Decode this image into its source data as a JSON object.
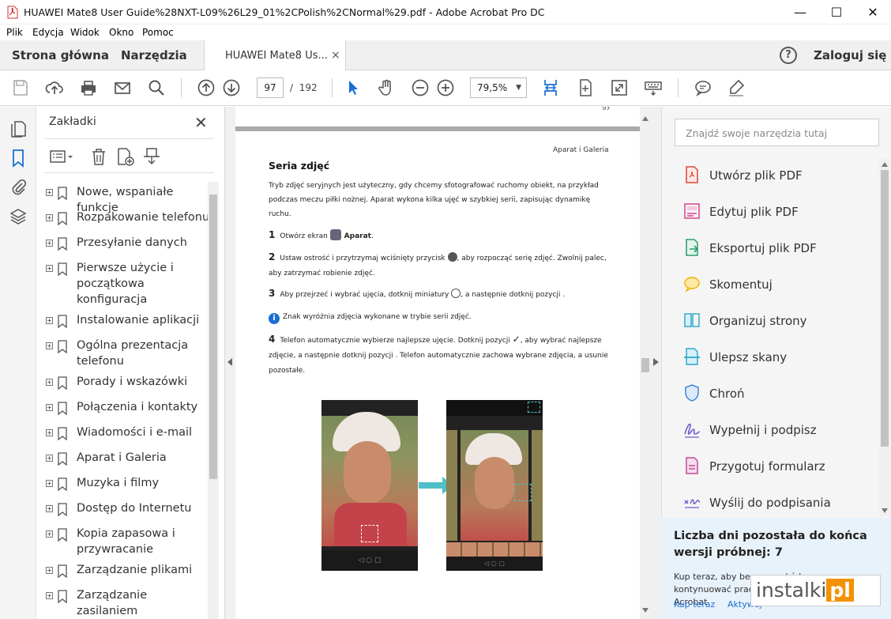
{
  "window": {
    "title": "HUAWEI Mate8 User Guide%28NXT-L09%26L29_01%2CPolish%2CNormal%29.pdf - Adobe Acrobat Pro DC",
    "minimize": "—",
    "maximize": "☐",
    "close": "✕"
  },
  "menu": [
    "Plik",
    "Edycja",
    "Widok",
    "Okno",
    "Pomoc"
  ],
  "tabs": {
    "home": "Strona główna",
    "tools": "Narzędzia",
    "document": "HUAWEI Mate8 Us...",
    "close": "×",
    "help": "?",
    "login": "Zaloguj się"
  },
  "toolbar": {
    "icons": [
      "save-icon",
      "upload-icon",
      "print-icon",
      "email-icon",
      "search-icon",
      "page-up-icon",
      "page-down-icon",
      "select-cursor-icon",
      "hand-icon",
      "zoom-out-icon",
      "zoom-in-icon",
      "fit-width-icon",
      "rotate-icon",
      "fullscreen-icon",
      "keyboard-icon",
      "comment-icon",
      "highlight-icon"
    ],
    "page_current": "97",
    "page_sep": "/",
    "page_total": "192",
    "zoom": "79,5%",
    "zoom_arrow": "▼"
  },
  "bookmarks": {
    "header": "Zakładki",
    "close": "✕",
    "expand_symbol": "+",
    "items": [
      "Nowe, wspaniałe funkcje",
      "Rozpakowanie telefonu",
      "Przesyłanie danych",
      "Pierwsze użycie i początkowa konfiguracja",
      "Instalowanie aplikacji",
      "Ogólna prezentacja telefonu",
      "Porady i wskazówki",
      "Połączenia i kontakty",
      "Wiadomości i e-mail",
      "Aparat i Galeria",
      "Muzyka i filmy",
      "Dostęp do Internetu",
      "Kopia zapasowa i przywracanie",
      "Zarządzanie plikami",
      "Zarządzanie zasilaniem"
    ]
  },
  "document": {
    "running_header": "Aparat i Galeria",
    "heading": "Seria  zdjęć",
    "intro": "Tryb zdjęć seryjnych jest użyteczny, gdy chcemy sfotografować ruchomy obiekt, na przykład podczas meczu piłki nożnej. Aparat wykona kilka ujęć w szybkiej serii, zapisując dynamikę ruchu.",
    "steps": [
      {
        "n": "1",
        "a": "Otwórz ekran ",
        "b": "Aparat",
        "c": "."
      },
      {
        "n": "2",
        "a": "Ustaw ostrość i przytrzymaj wciśnięty przycisk ",
        "b": "",
        "c": ", aby rozpocząć serię zdjęć. Zwolnij palec, aby zatrzymać robienie zdjęć."
      },
      {
        "n": "3",
        "a": "Aby przejrzeć i wybrać ujęcia, dotknij miniatury ",
        "b": "",
        "c": ", a następnie dotknij pozycji  ."
      },
      {
        "n": "4",
        "a": "Telefon automatycznie wybierze najlepsze ujęcie. Dotknij pozycji ",
        "b": "",
        "c": ", aby wybrać najlepsze zdjęcie, a następnie dotknij pozycji   . Telefon automatycznie zachowa wybrane zdjęcia, a usunie pozostałe."
      }
    ],
    "note": "Znak   wyróżnia zdjęcia wykonane w trybie serii zdjęć.",
    "page_top_fragment": "gy"
  },
  "tools_panel": {
    "search_placeholder": "Znajdź swoje narzędzia tutaj",
    "items": [
      {
        "label": "Utwórz plik PDF",
        "icon": "create-pdf-icon",
        "color": "#e0473b"
      },
      {
        "label": "Edytuj plik PDF",
        "icon": "edit-pdf-icon",
        "color": "#d9438f"
      },
      {
        "label": "Eksportuj plik PDF",
        "icon": "export-pdf-icon",
        "color": "#2a9d6a"
      },
      {
        "label": "Skomentuj",
        "icon": "comment-icon",
        "color": "#f0b400"
      },
      {
        "label": "Organizuj strony",
        "icon": "organize-pages-icon",
        "color": "#2aa6c9"
      },
      {
        "label": "Ulepsz skany",
        "icon": "enhance-scans-icon",
        "color": "#2aa6c9"
      },
      {
        "label": "Chroń",
        "icon": "protect-shield-icon",
        "color": "#3b8ad9"
      },
      {
        "label": "Wypełnij i podpisz",
        "icon": "fill-sign-icon",
        "color": "#6c5ccf"
      },
      {
        "label": "Przygotuj formularz",
        "icon": "prepare-form-icon",
        "color": "#c44a9a"
      },
      {
        "label": "Wyślij do podpisania",
        "icon": "send-for-signature-icon",
        "color": "#6c5ccf"
      }
    ]
  },
  "trial": {
    "title": "Liczba dni pozostała do końca wersji próbnej: 7",
    "desc": "Kup teraz, aby bez przeszkód kontynuować pracę z programem Acrobat",
    "buy": "Kup teraz",
    "activate": "Aktywuj"
  },
  "watermark": {
    "a": "instalki",
    "b": "pl"
  },
  "colors": {
    "accent": "#1a6fd1",
    "brand_red": "#e0473b"
  }
}
